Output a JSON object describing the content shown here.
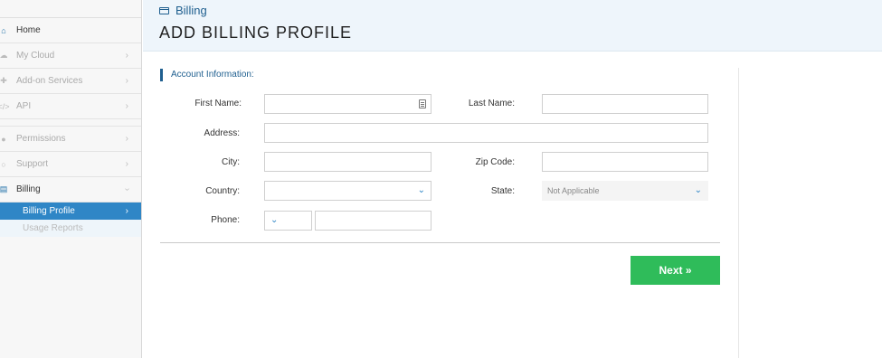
{
  "sidebar": {
    "items": [
      {
        "label": "Home",
        "icon": "home-icon"
      },
      {
        "label": "My Cloud",
        "icon": "cloud-icon"
      },
      {
        "label": "Add-on Services",
        "icon": "puzzle-icon"
      },
      {
        "label": "API",
        "icon": "code-icon"
      },
      {
        "label": "Permissions",
        "icon": "users-icon"
      },
      {
        "label": "Support",
        "icon": "headset-icon"
      },
      {
        "label": "Billing",
        "icon": "credit-card-icon"
      }
    ],
    "billing_sub": {
      "active": "Billing Profile",
      "other": "Usage Reports"
    }
  },
  "header": {
    "breadcrumb": "Billing",
    "title": "ADD BILLING PROFILE"
  },
  "form": {
    "section": "Account Information:",
    "first_name_label": "First Name:",
    "last_name_label": "Last Name:",
    "address_label": "Address:",
    "city_label": "City:",
    "zip_label": "Zip Code:",
    "country_label": "Country:",
    "state_label": "State:",
    "state_value": "Not Applicable",
    "phone_label": "Phone:"
  },
  "actions": {
    "next_label": "Next »"
  },
  "colors": {
    "accent": "#2f86c6",
    "primary_text": "#1f5f8f",
    "next_button": "#2fbc5a"
  }
}
